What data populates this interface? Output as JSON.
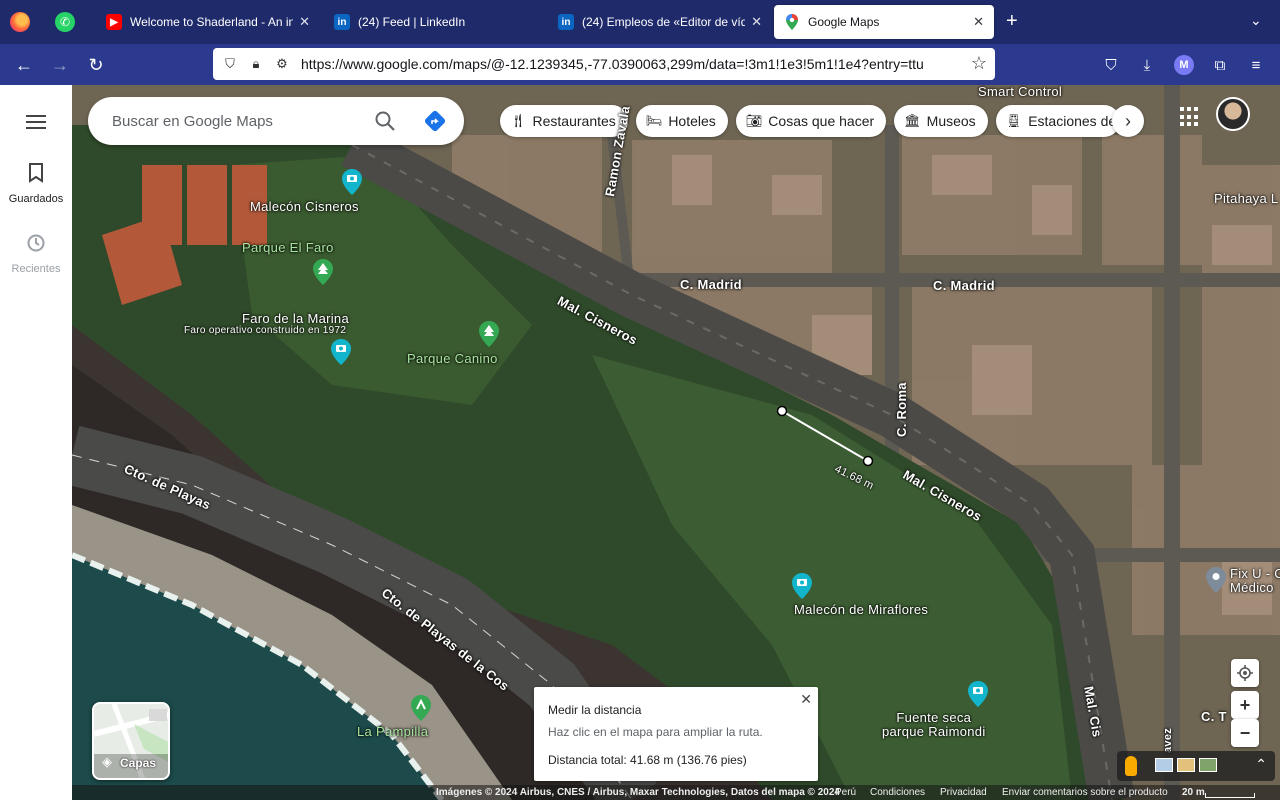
{
  "browser": {
    "tabs": [
      {
        "title": "Welcome to Shaderland - An int",
        "favicon": "youtube-icon",
        "color": "#ff0000"
      },
      {
        "title": "(24) Feed | LinkedIn",
        "favicon": "linkedin-icon",
        "color": "#0a66c2"
      },
      {
        "title": "(24) Empleos de «Editor de víde",
        "favicon": "linkedin-icon",
        "color": "#0a66c2"
      },
      {
        "title": "Google Maps",
        "favicon": "maps-icon",
        "color": "#34a853"
      }
    ],
    "url": "https://www.google.com/maps/@-12.1239345,-77.0390063,299m/data=!3m1!1e3!5m1!1e4?entry=ttu",
    "account_initial": "M"
  },
  "rail": {
    "saved_label": "Guardados",
    "recent_label": "Recientes"
  },
  "search": {
    "placeholder": "Buscar en Google Maps"
  },
  "chips": [
    {
      "label": "Restaurantes",
      "icon": "fork-knife-icon"
    },
    {
      "label": "Hoteles",
      "icon": "bed-icon"
    },
    {
      "label": "Cosas que hacer",
      "icon": "camera-icon"
    },
    {
      "label": "Museos",
      "icon": "museum-icon"
    },
    {
      "label": "Estaciones de t",
      "icon": "train-icon"
    }
  ],
  "map_labels": {
    "smart_control": "Smart Control",
    "pitahaya": "Pitahaya L",
    "ramon_zavala": "Ramon Zavala",
    "c_madrid_1": "C. Madrid",
    "c_madrid_2": "C. Madrid",
    "mal_cisneros_1": "Mal. Cisneros",
    "mal_cisneros_2": "Mal. Cisneros",
    "c_roma": "C. Roma",
    "malecon_cisneros": "Malecón Cisneros",
    "parque_el_faro": "Parque El Faro",
    "faro_marina": "Faro de la Marina",
    "faro_desc": "Faro operativo construido en 1972",
    "parque_canino": "Parque Canino",
    "cto_playas": "Cto. de Playas",
    "cto_playas_cos": "Cto. de Playas de la Cos",
    "malecon_miraflores": "Malecón de Miraflores",
    "fix_u_1": "Fix U - C",
    "fix_u_2": "Médico",
    "fuente_1": "Fuente seca",
    "fuente_2": "parque Raimondi",
    "la_pampilla": "La Pampilla",
    "mal_cis_v": "Mal. Cis",
    "c_t": "C. T",
    "c_t_2": "i",
    "avez": "avez",
    "distance_tag": "41.68 m"
  },
  "measure_panel": {
    "title": "Medir la distancia",
    "hint": "Haz clic en el mapa para ampliar la ruta.",
    "total": "Distancia total: 41.68 m (136.76 pies)"
  },
  "layers": {
    "label": "Capas"
  },
  "footer": {
    "attribution": "Imágenes © 2024 Airbus, CNES / Airbus, Maxar Technologies, Datos del mapa © 2024",
    "country": "Perú",
    "terms": "Condiciones",
    "privacy": "Privacidad",
    "feedback": "Enviar comentarios sobre el producto",
    "scale": "20 m"
  }
}
